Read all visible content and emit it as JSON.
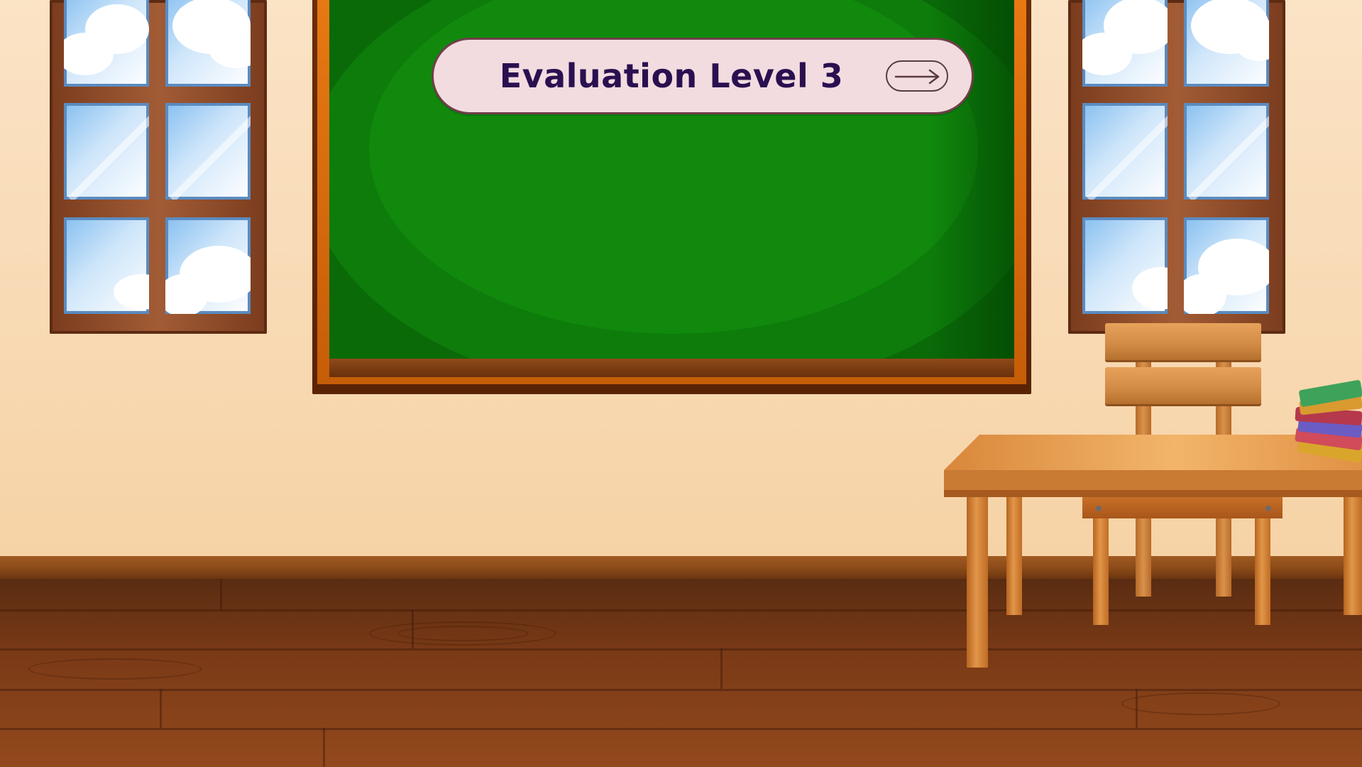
{
  "screen": {
    "title": "Evaluation Level 3",
    "next_button_icon": "arrow-right-icon"
  },
  "colors": {
    "wall": "#f9e0c1",
    "chalkboard": "#10890d",
    "board_frame": "#e87812",
    "title_pill": "#f2dcdf",
    "title_text": "#2a1050",
    "floor": "#7a3a16"
  },
  "scene": {
    "objects": [
      "left-window",
      "chalkboard",
      "right-window",
      "chair",
      "desk",
      "book-stack",
      "wooden-floor"
    ]
  }
}
